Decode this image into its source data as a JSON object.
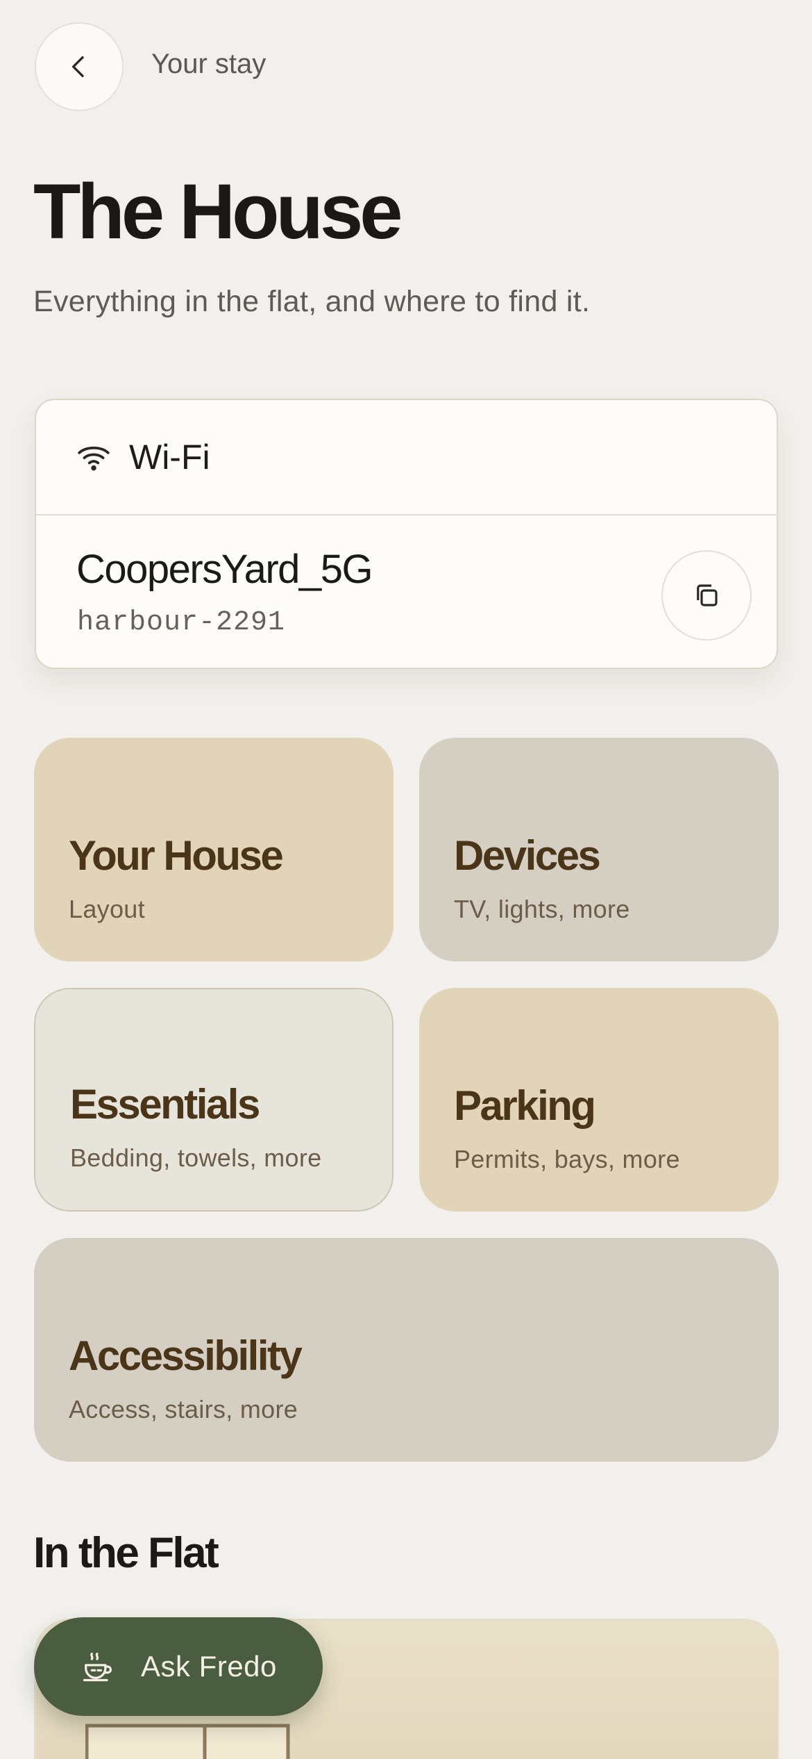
{
  "header": {
    "breadcrumb": "Your stay",
    "back_icon": "chevron-left-icon"
  },
  "page": {
    "title": "The House",
    "subtitle": "Everything in the flat, and where to find it."
  },
  "wifi": {
    "label": "Wi-Fi",
    "network_name": "CoopersYard_5G",
    "password": "harbour-2291",
    "icon": "wifi-icon",
    "copy_icon": "copy-icon"
  },
  "tiles": [
    {
      "title": "Your House",
      "subtitle": "Layout",
      "color": "#e2d4b8"
    },
    {
      "title": "Devices",
      "subtitle": "TV, lights, more",
      "color": "#d5cec2"
    },
    {
      "title": "Essentials",
      "subtitle": "Bedding, towels, more",
      "color": "#e7e4dc"
    },
    {
      "title": "Parking",
      "subtitle": "Permits, bays, more",
      "color": "#e2d4b8"
    },
    {
      "title": "Accessibility",
      "subtitle": "Access, stairs, more",
      "color": "#d5cec2"
    }
  ],
  "section": {
    "title": "In the Flat"
  },
  "assistant": {
    "label": "Ask Fredo",
    "icon": "coffee-cup-icon",
    "color": "#4a5d40"
  }
}
